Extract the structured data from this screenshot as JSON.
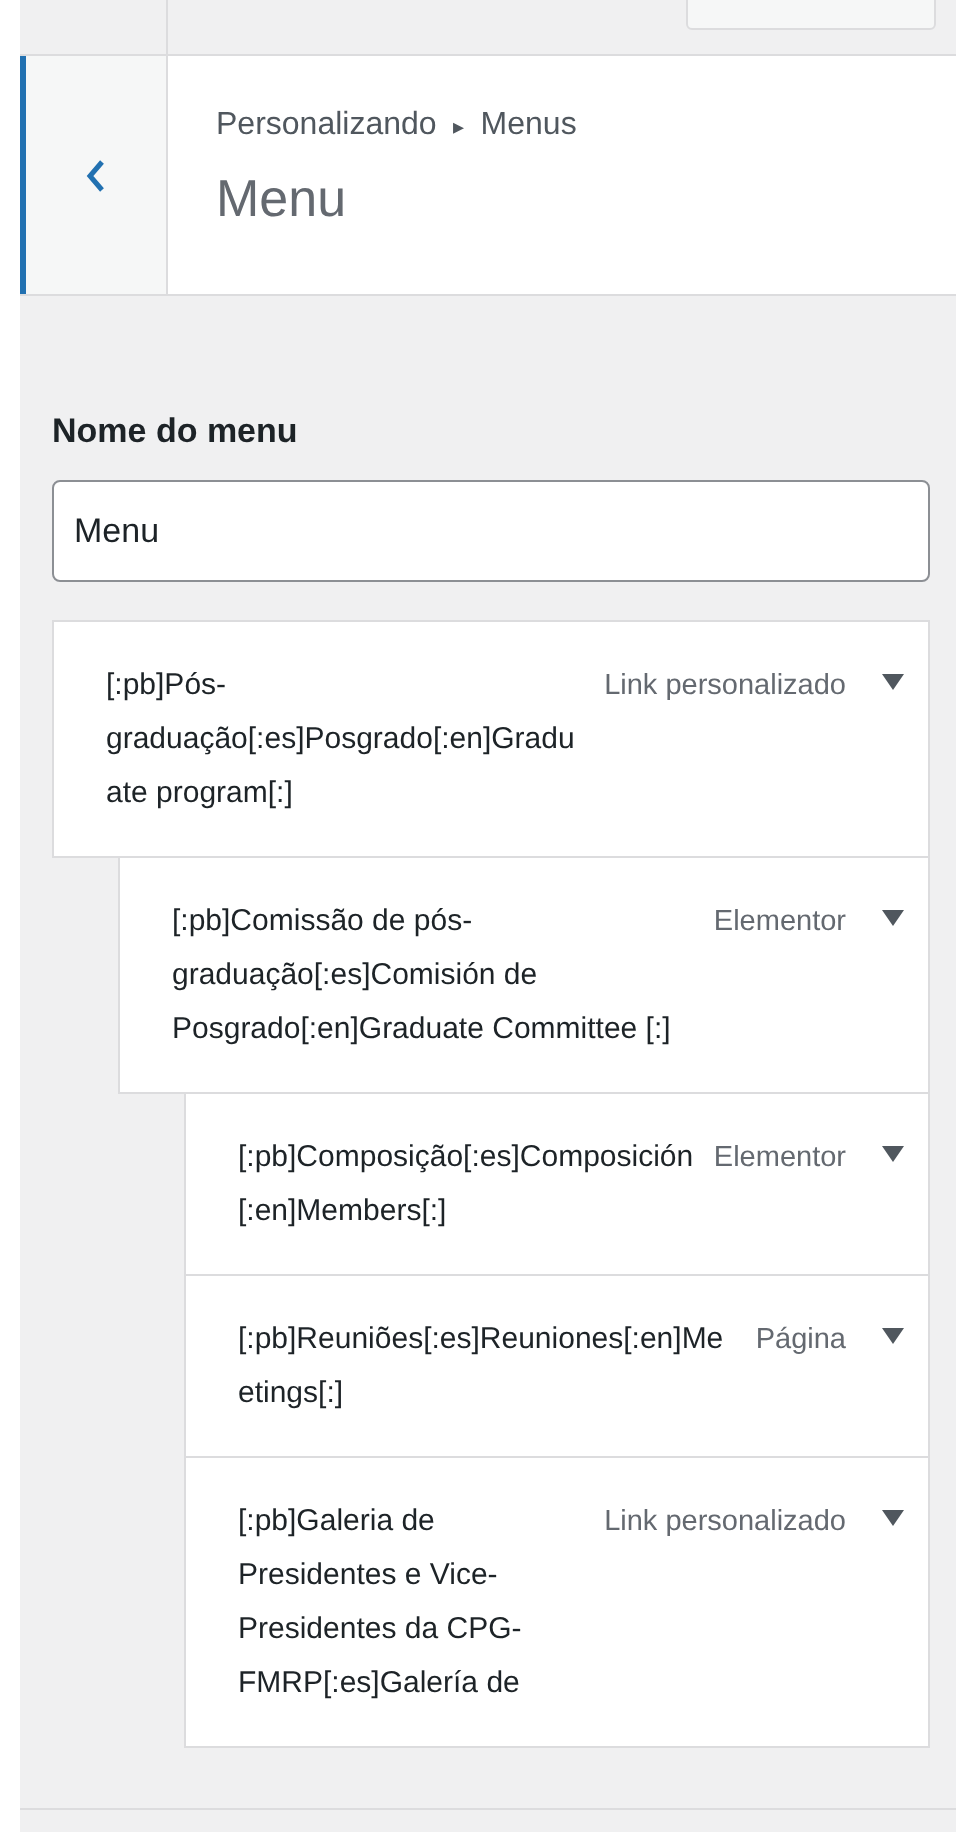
{
  "header": {
    "breadcrumb": "Personalizando",
    "breadcrumb_separator": "▸",
    "breadcrumb_current": "Menus",
    "title": "Menu"
  },
  "menu_name": {
    "label": "Nome do menu",
    "value": "Menu"
  },
  "menu_items": [
    {
      "title": "[:pb]Pós-graduação[:es]Posgrado[:en]Graduate program[:]",
      "type": "Link personalizado",
      "expanded": false,
      "children": [
        {
          "title": "[:pb]Comissão de pós-graduação[:es]Comisión de Posgrado[:en]Graduate Committee [:]",
          "type": "Elementor",
          "expanded": false,
          "children": [
            {
              "title": "[:pb]Composição[:es]Composición[:en]Members[:]",
              "type": "Elementor",
              "expanded": false
            },
            {
              "title": "[:pb]Reuniões[:es]Reuniones[:en]Meetings[:]",
              "type": "Página",
              "expanded": false
            },
            {
              "title": "[:pb]Galeria de Presidentes e Vice-Presidentes da CPG-FMRP[:es]Galería de",
              "type": "Link personalizado",
              "expanded": false
            }
          ]
        }
      ]
    }
  ]
}
